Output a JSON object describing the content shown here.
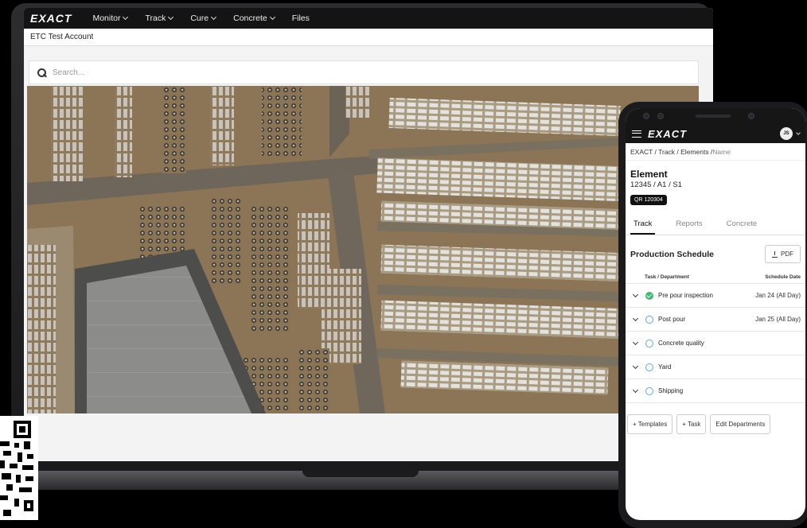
{
  "laptop": {
    "brand": "EXACT",
    "nav": [
      {
        "label": "Monitor"
      },
      {
        "label": "Track"
      },
      {
        "label": "Cure"
      },
      {
        "label": "Concrete"
      },
      {
        "label": "Files"
      }
    ],
    "account": "ETC Test Account",
    "search": {
      "placeholder": "Search..."
    },
    "map_image": "aerial-precast-yard"
  },
  "phone": {
    "brand": "EXACT",
    "avatar_initials": "JS",
    "breadcrumb": {
      "path": "EXACT / Track / Elements / ",
      "current": "Name"
    },
    "element": {
      "title": "Element",
      "code": "12345 / A1 / S1",
      "qr": "QR 120304"
    },
    "tabs": [
      "Track",
      "Reports",
      "Concrete"
    ],
    "active_tab": "Track",
    "schedule": {
      "title": "Production Schedule",
      "pdf_label": "PDF",
      "col_task": "Task / Department",
      "col_date": "Schedule Date",
      "tasks": [
        {
          "name": "Pre pour inspection",
          "date": "Jan 24 (All Day)",
          "status": "done"
        },
        {
          "name": "Post pour",
          "date": "Jan 25 (All Day)",
          "status": "open"
        },
        {
          "name": "Concrete quality",
          "date": "",
          "status": "open"
        },
        {
          "name": "Yard",
          "date": "",
          "status": "open"
        },
        {
          "name": "Shipping",
          "date": "",
          "status": "open"
        }
      ]
    },
    "buttons": {
      "templates": "+ Templates",
      "task": "+ Task",
      "edit_departments": "Edit Departments"
    }
  },
  "colors": {
    "accent_done": "#3bbf6a",
    "accent_open": "#5aa8e6",
    "nav_bg": "#141414"
  }
}
